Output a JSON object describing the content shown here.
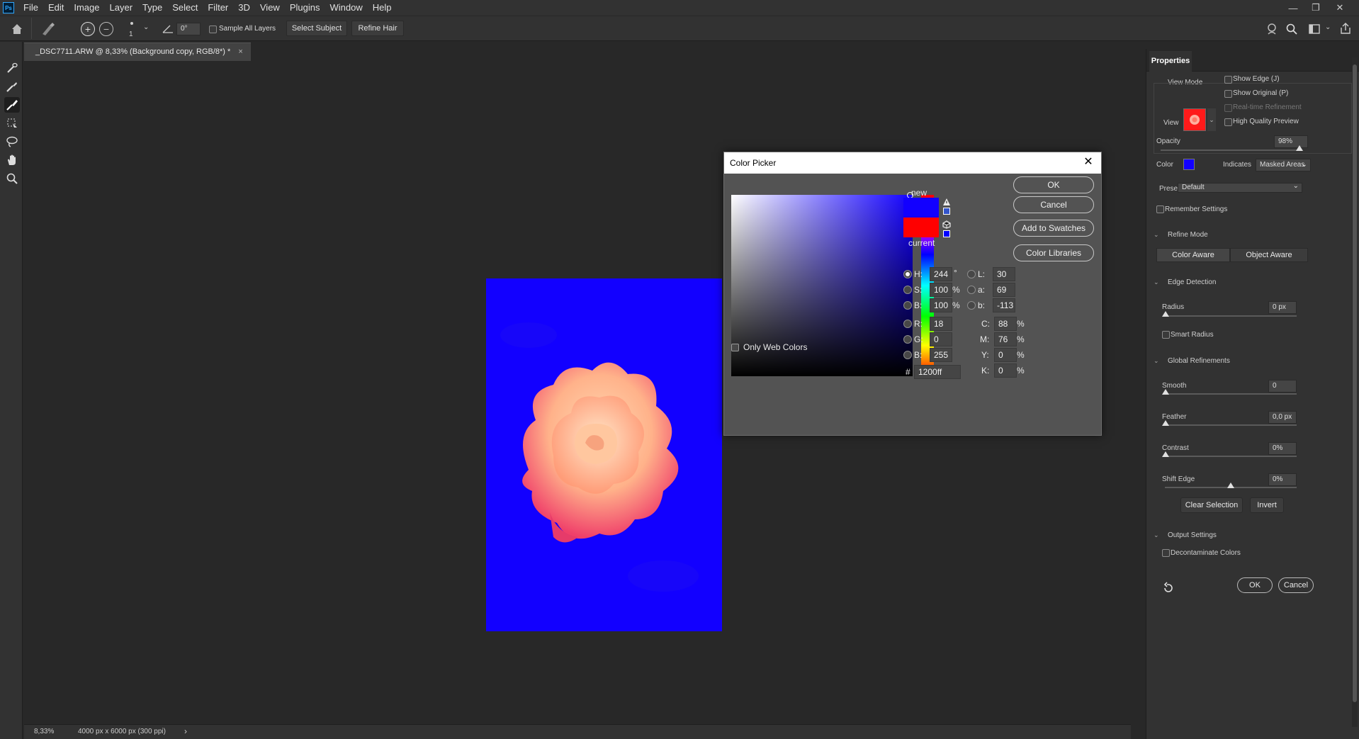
{
  "app": {
    "logo_text": "Ps",
    "menu": [
      "File",
      "Edit",
      "Image",
      "Layer",
      "Type",
      "Select",
      "Filter",
      "3D",
      "View",
      "Plugins",
      "Window",
      "Help"
    ]
  },
  "options_bar": {
    "brush_size": "1",
    "angle_value": "0°",
    "sample_all_layers": "Sample All Layers",
    "select_subject": "Select Subject",
    "refine_hair": "Refine Hair"
  },
  "document": {
    "tab_title": "_DSC7711.ARW @ 8,33% (Background copy, RGB/8*) *",
    "close_glyph": "×",
    "zoom": "8,33%",
    "dimensions": "4000 px x 6000 px (300 ppi)",
    "status_arrow": "›"
  },
  "properties": {
    "tab": "Properties",
    "view_mode_title": "View Mode",
    "view_label": "View",
    "show_edge": "Show Edge (J)",
    "show_original": "Show Original (P)",
    "realtime_refinement": "Real-time Refinement",
    "high_quality_preview": "High Quality Preview",
    "opacity_label": "Opacity",
    "opacity_value": "98%",
    "opacity_fraction": 0.98,
    "color_label": "Color",
    "color_swatch": "#1200ff",
    "indicates_label": "Indicates",
    "indicates_value": "Masked Areas",
    "preset_label": "Preset",
    "preset_value": "Default",
    "remember_settings": "Remember Settings",
    "refine_mode_title": "Refine Mode",
    "color_aware": "Color Aware",
    "object_aware": "Object Aware",
    "edge_detection_title": "Edge Detection",
    "radius_label": "Radius",
    "radius_value": "0 px",
    "smart_radius": "Smart Radius",
    "global_refinements_title": "Global Refinements",
    "smooth_label": "Smooth",
    "smooth_value": "0",
    "feather_label": "Feather",
    "feather_value": "0,0 px",
    "contrast_label": "Contrast",
    "contrast_value": "0%",
    "shift_edge_label": "Shift Edge",
    "shift_edge_value": "0%",
    "clear_selection": "Clear Selection",
    "invert": "Invert",
    "output_settings_title": "Output Settings",
    "decontaminate_colors": "Decontaminate Colors",
    "ok": "OK",
    "cancel": "Cancel"
  },
  "color_picker": {
    "title": "Color Picker",
    "close_glyph": "✕",
    "ok": "OK",
    "cancel": "Cancel",
    "add_to_swatches": "Add to Swatches",
    "color_libraries": "Color Libraries",
    "new_label": "new",
    "current_label": "current",
    "new_color": "#1200ff",
    "current_color": "#ff0000",
    "only_web_colors": "Only Web Colors",
    "h_label": "H:",
    "h_value": "244",
    "h_unit": "°",
    "s_label": "S:",
    "s_value": "100",
    "s_unit": "%",
    "b_label": "B:",
    "b_value": "100",
    "b_unit": "%",
    "r_label": "R:",
    "r_value": "18",
    "g_label": "G:",
    "g_value": "0",
    "bb_label": "B:",
    "bb_value": "255",
    "l_label": "L:",
    "l_value": "30",
    "a_label": "a:",
    "a_value": "69",
    "lb_label": "b:",
    "lb_value": "-113",
    "c_label": "C:",
    "c_value": "88",
    "m_label": "M:",
    "m_value": "76",
    "y_label": "Y:",
    "y_value": "0",
    "k_label": "K:",
    "k_value": "0",
    "cmyk_unit": "%",
    "hex_label": "#",
    "hex_value": "1200ff"
  }
}
